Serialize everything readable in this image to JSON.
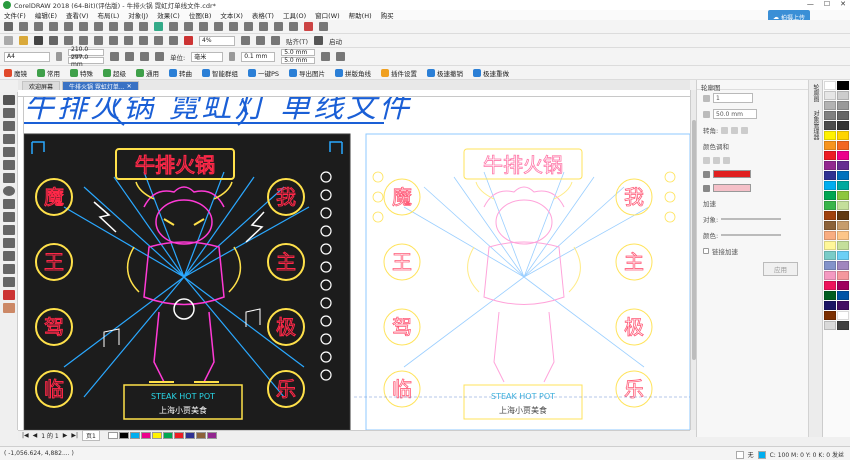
{
  "window": {
    "title": "CorelDRAW 2018 (64-Bit)(评估版) - 牛排火锅 霓虹灯单线文件.cdr*",
    "controls": [
      "—",
      "☐",
      "✕"
    ]
  },
  "menu": [
    "文件(F)",
    "编辑(E)",
    "查看(V)",
    "布局(L)",
    "对象(J)",
    "效果(C)",
    "位图(B)",
    "文本(X)",
    "表格(T)",
    "工具(O)",
    "窗口(W)",
    "帮助(H)",
    "购买"
  ],
  "cloud_button": "拍摄上传",
  "standard_bar": {
    "zoom": "4%",
    "snap": "贴齐(T)",
    "launch": "启动"
  },
  "property_bar": {
    "page_size": "A4",
    "width": "210.0 mm",
    "height": "297.0 mm",
    "units_label": "单位:",
    "units": "毫米",
    "nudge": "0.1 mm",
    "dup_x": "5.0 mm",
    "dup_y": "5.0 mm"
  },
  "plugin_bar": [
    {
      "label": "魔镜",
      "color": "#e0492b"
    },
    {
      "label": "常用",
      "color": "#3fa04a"
    },
    {
      "label": "特殊",
      "color": "#3fa04a"
    },
    {
      "label": "超级",
      "color": "#3fa04a"
    },
    {
      "label": "通用",
      "color": "#3fa04a"
    },
    {
      "label": "转曲",
      "color": "#2b7fd6"
    },
    {
      "label": "智能群组",
      "color": "#2b7fd6"
    },
    {
      "label": "一键PS",
      "color": "#2b7fd6"
    },
    {
      "label": "导出图片",
      "color": "#2b7fd6"
    },
    {
      "label": "拼版角线",
      "color": "#2b7fd6"
    },
    {
      "label": "插件设置",
      "color": "#f0a020"
    },
    {
      "label": "极速撤销",
      "color": "#2b7fd6"
    },
    {
      "label": "极速重做",
      "color": "#2b7fd6"
    }
  ],
  "doc_tabs": [
    {
      "label": "欢迎屏幕",
      "active": false
    },
    {
      "label": "牛排火锅 霓虹灯单...",
      "active": true
    }
  ],
  "design": {
    "heading_handwritten": "牛排火锅 霓虹灯 单线文件",
    "sign_title": "牛排火锅",
    "left_chars": [
      "魔",
      "王",
      "驾",
      "临"
    ],
    "right_chars": [
      "我",
      "主",
      "极",
      "乐"
    ],
    "footer_en": "STEAK HOT POT",
    "footer_cn": "上海小贾美食",
    "colors": {
      "dark_bg": "#1c1c1c",
      "neon_red": "#ff2848",
      "neon_yellow": "#ffe14a",
      "neon_blue": "#2aa8ff",
      "neon_pink": "#ff3ad6",
      "neon_cyan": "#29d8e8",
      "annotation_blue": "#1a5fd6",
      "annotation_pink": "#e0146e"
    }
  },
  "docker": {
    "title": "轮廓图",
    "value_steps": "1",
    "value_offset": "50.0 mm",
    "corner_label": "转角:",
    "color_mix_label": "颜色调和",
    "accel_label": "加速",
    "object_label": "对象:",
    "color_label": "颜色:",
    "link_label": "链接加速",
    "apply_button": "应用",
    "outline_color": "#e02020",
    "fill_color": "#f5c0c8"
  },
  "side_tabs": [
    "轮廓图",
    "对象管理器"
  ],
  "palette": [
    "#ffffff",
    "#000000",
    "#e6e6e6",
    "#cccccc",
    "#b3b3b3",
    "#999999",
    "#808080",
    "#666666",
    "#4d4d4d",
    "#333333",
    "#fff200",
    "#ffd400",
    "#f7941d",
    "#f26522",
    "#ed1c24",
    "#ec008c",
    "#92278f",
    "#662d91",
    "#2e3192",
    "#0072bc",
    "#00aeef",
    "#00a99d",
    "#00a651",
    "#8dc63f",
    "#39b54a",
    "#c4df9b",
    "#a0410d",
    "#603913",
    "#8c6239",
    "#c69c6d",
    "#f9ad81",
    "#fdc689",
    "#fff799",
    "#c4df9b",
    "#7accc8",
    "#6dcff6",
    "#8393ca",
    "#a186be",
    "#f49ac1",
    "#f5989d",
    "#ed145b",
    "#9e005d",
    "#005e20",
    "#0054a6",
    "#1b1464",
    "#440e62",
    "#7b2e00",
    "#ffffff",
    "#d9d9d9",
    "#404040"
  ],
  "page_nav": {
    "text": "1 的 1",
    "page_tab": "页1"
  },
  "page_bar_colors": [
    "#ffffff",
    "#000000",
    "#00aeef",
    "#ec008c",
    "#fff200",
    "#00a651",
    "#ed1c24",
    "#2e3192",
    "#8c6239",
    "#92278f"
  ],
  "status": {
    "coords": "( -1,056.624, 4,882.... )",
    "fill_info": "C: 100 M: 0 Y: 0 K: 0  发丝",
    "none": "无"
  }
}
